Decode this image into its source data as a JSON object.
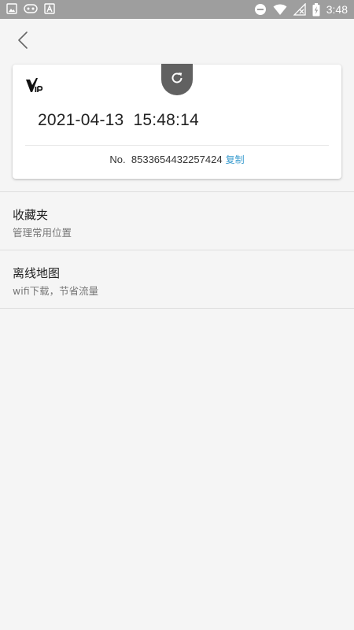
{
  "status_bar": {
    "time": "3:48",
    "left_icons": [
      "image-icon",
      "game-controller-icon",
      "app-font-icon"
    ],
    "right_icons": [
      "do-not-disturb-icon",
      "wifi-icon",
      "no-signal-icon",
      "battery-charging-icon"
    ]
  },
  "header": {
    "back_icon": "chevron-left-icon"
  },
  "card": {
    "vip_logo": "VIP",
    "refresh_icon": "refresh-icon",
    "datetime": "2021-04-13  15:48:14",
    "number_label": "No.",
    "number": "8533654432257424",
    "copy_label": "复制",
    "accent_color": "#3a9ccf",
    "tab_color": "#616161"
  },
  "list": {
    "items": [
      {
        "title": "收藏夹",
        "subtitle": "管理常用位置"
      },
      {
        "title": "离线地图",
        "subtitle": "wifi下载，节省流量"
      }
    ]
  }
}
